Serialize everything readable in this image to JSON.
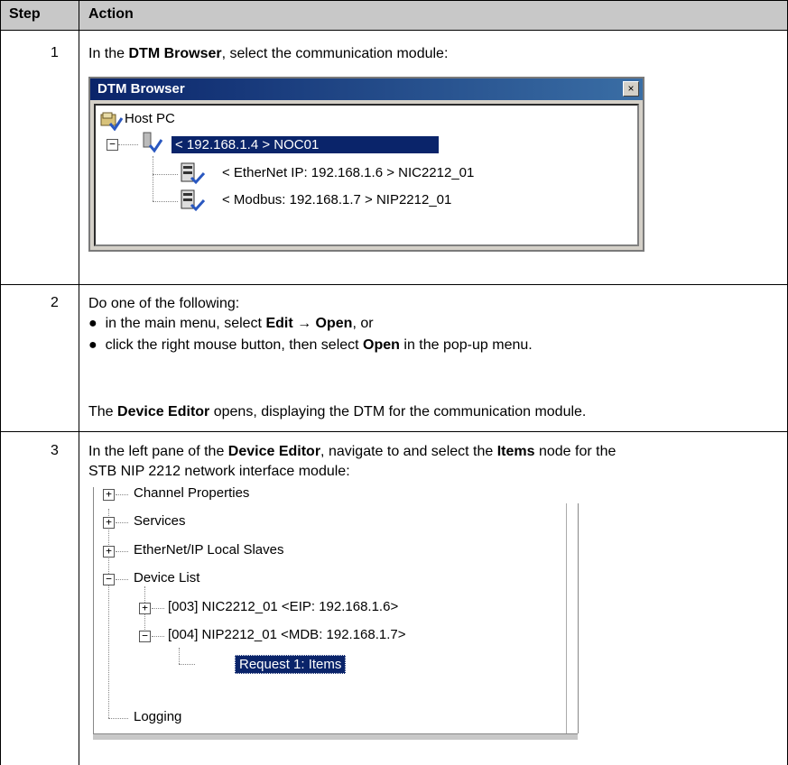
{
  "header": {
    "step": "Step",
    "action": "Action"
  },
  "rows": [
    {
      "step": "1",
      "text_before": "In the ",
      "text_bold": "DTM Browser",
      "text_after": ", select the communication module:",
      "dtm_browser": {
        "title": "DTM Browser",
        "close": "×",
        "host": "Host PC",
        "noc": "< 192.168.1.4 > NOC01",
        "nic": "< EtherNet IP: 192.168.1.6 > NIC2212_01",
        "nip": "< Modbus: 192.168.1.7 > NIP2212_01"
      }
    },
    {
      "step": "2",
      "intro": "Do one of the following:",
      "bullet1_a": "in the main menu, select ",
      "bullet1_b": "Edit",
      "bullet1_c": " → ",
      "bullet1_d": "Open",
      "bullet1_e": ", or",
      "bullet2_a": "click the right mouse button, then select ",
      "bullet2_b": "Open",
      "bullet2_c": " in the pop-up menu.",
      "result_a": "The ",
      "result_b": "Device Editor",
      "result_c": " opens, displaying the DTM for the communication module."
    },
    {
      "step": "3",
      "line1_a": "In the left pane of the ",
      "line1_b": "Device Editor",
      "line1_c": ", navigate to and select the ",
      "line1_d": "Items",
      "line1_e": " node for the",
      "line2": "STB NIP 2212 network interface module:",
      "tree": {
        "channel": "Channel Properties",
        "services": "Services",
        "ethernet": "EtherNet/IP Local Slaves",
        "device_list": "Device List",
        "nic": "[003] NIC2212_01 <EIP: 192.168.1.6>",
        "nip": "[004] NIP2212_01 <MDB: 192.168.1.7>",
        "request": "Request 1: Items",
        "logging": "Logging"
      }
    }
  ]
}
